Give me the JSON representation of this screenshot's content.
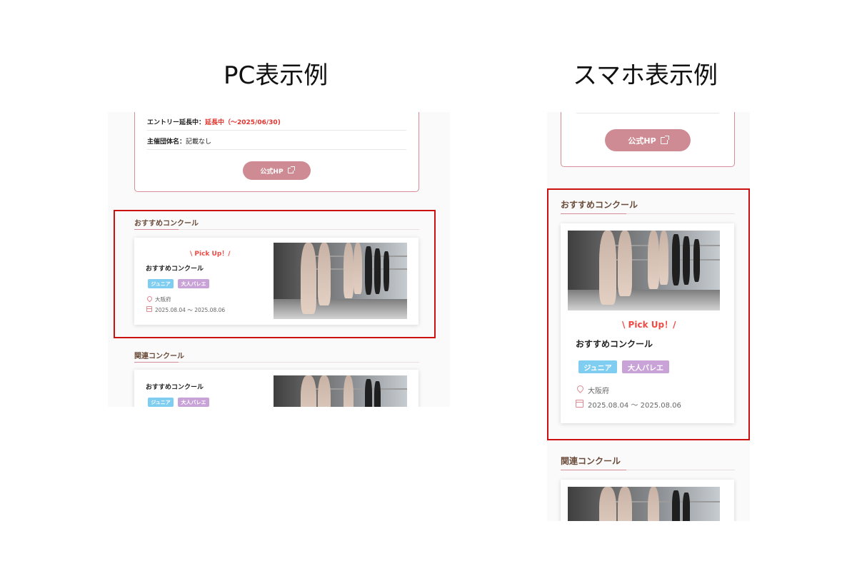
{
  "headings": {
    "pc": "PC表示例",
    "sp": "スマホ表示例"
  },
  "info": {
    "entry_label": "エントリー延長中：",
    "entry_value": "延長中（〜2025/06/30)",
    "organizer_label": "主催団体名：",
    "organizer_value": "記載なし",
    "hp_button": "公式HP"
  },
  "recommended": {
    "section_title": "おすすめコンクール",
    "pickup": "\\ Pick Up！/",
    "card_title": "おすすめコンクール",
    "tags": [
      "ジュニア",
      "大人バレエ"
    ],
    "location": "大阪府",
    "dates": "2025.08.04 〜 2025.08.06"
  },
  "related": {
    "section_title": "関連コンクール",
    "card_title": "おすすめコンクール",
    "tags": [
      "ジュニア",
      "大人バレエ"
    ]
  },
  "colors": {
    "accent_pink": "#d58e97",
    "button_pink": "#cf8b93",
    "pickup_red": "#ef4b45",
    "tag_junior": "#7fcdf0",
    "tag_adult": "#c9a3d8",
    "section_title": "#6b4b3a",
    "highlight_box": "#cc1111"
  }
}
